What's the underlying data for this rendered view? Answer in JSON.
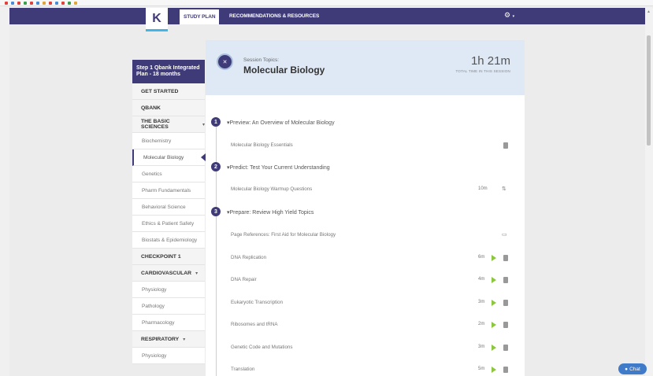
{
  "colors": {
    "brand": "#3f3a78",
    "accent": "#41b6e6",
    "play": "#8dc63f",
    "header_bg": "#dfe9f6"
  },
  "logo": {
    "letter": "K"
  },
  "nav": {
    "tabs": [
      {
        "label": "STUDY PLAN",
        "active": true
      },
      {
        "label": "RECOMMENDATIONS & RESOURCES",
        "active": false
      }
    ],
    "settings_icon": "gear-icon",
    "settings_caret": "▾"
  },
  "sidebar": {
    "plan_title": "Step 1 Qbank Integrated Plan - 18 months",
    "items": [
      {
        "label": "GET STARTED",
        "type": "section"
      },
      {
        "label": "QBANK",
        "type": "section"
      },
      {
        "label": "THE BASIC SCIENCES",
        "type": "section",
        "expanded": true
      },
      {
        "label": "Biochemistry",
        "type": "sub"
      },
      {
        "label": "Molecular Biology",
        "type": "sub",
        "active": true
      },
      {
        "label": "Genetics",
        "type": "sub"
      },
      {
        "label": "Pharm Fundamentals",
        "type": "sub"
      },
      {
        "label": "Behavioral Science",
        "type": "sub"
      },
      {
        "label": "Ethics & Patient Safety",
        "type": "sub"
      },
      {
        "label": "Biostats & Epidemiology",
        "type": "sub"
      },
      {
        "label": "CHECKPOINT 1",
        "type": "section"
      },
      {
        "label": "CARDIOVASCULAR",
        "type": "section",
        "expanded": true
      },
      {
        "label": "Physiology",
        "type": "sub"
      },
      {
        "label": "Pathology",
        "type": "sub"
      },
      {
        "label": "Pharmacology",
        "type": "sub"
      },
      {
        "label": "RESPIRATORY",
        "type": "section",
        "expanded": true
      },
      {
        "label": "Physiology",
        "type": "sub"
      }
    ]
  },
  "session": {
    "topic_label": "Session Topics:",
    "topic_name": "Molecular Biology",
    "total_time": "1h 21m",
    "total_time_label": "TOTAL TIME IN THIS SESSION",
    "steps": [
      {
        "num": "1",
        "title": "▾Preview: An Overview of Molecular Biology"
      },
      {
        "num": "2",
        "title": "▾Predict: Test Your Current Understanding"
      },
      {
        "num": "3",
        "title": "▾Prepare: Review High Yield Topics"
      }
    ],
    "rows": [
      {
        "label": "Molecular Biology Essentials",
        "duration": "",
        "icon": "document-icon"
      },
      {
        "label": "Molecular Biology Warmup Questions",
        "duration": "10m",
        "icon": "question-set-icon"
      },
      {
        "label": "Page References: First Aid for Molecular Biology",
        "duration": "",
        "icon": "book-icon"
      },
      {
        "label": "DNA Replication",
        "duration": "6m",
        "icon": "play-icon"
      },
      {
        "label": "DNA Repair",
        "duration": "4m",
        "icon": "play-icon"
      },
      {
        "label": "Eukaryotic Transcription",
        "duration": "3m",
        "icon": "play-icon"
      },
      {
        "label": "Ribosomes and tRNA",
        "duration": "2m",
        "icon": "play-icon"
      },
      {
        "label": "Genetic Code and Mutations",
        "duration": "3m",
        "icon": "play-icon"
      },
      {
        "label": "Translation",
        "duration": "5m",
        "icon": "play-icon"
      }
    ]
  },
  "chat": {
    "label": "Chat",
    "icon": "chat-bubble-icon"
  }
}
